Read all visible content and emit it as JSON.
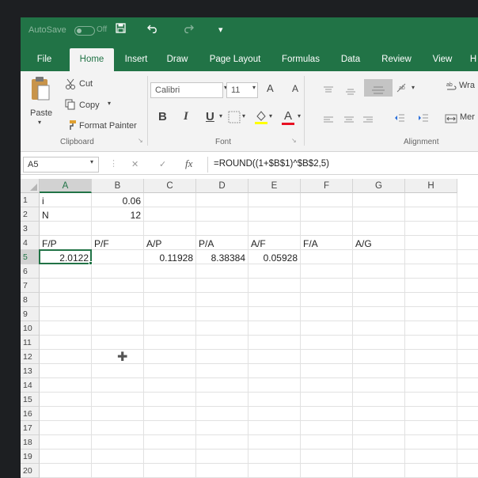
{
  "titlebar": {
    "autosave_label": "AutoSave",
    "autosave_state": "Off",
    "quick_access": [
      "save-icon",
      "undo-icon",
      "redo-icon",
      "customize-icon"
    ]
  },
  "tabs": [
    "File",
    "Home",
    "Insert",
    "Draw",
    "Page Layout",
    "Formulas",
    "Data",
    "Review",
    "View",
    "H"
  ],
  "active_tab": "Home",
  "ribbon": {
    "clipboard": {
      "paste": "Paste",
      "cut": "Cut",
      "copy": "Copy",
      "format_painter": "Format Painter",
      "label": "Clipboard"
    },
    "font": {
      "font_name": "Calibri",
      "font_size": "11",
      "bold": "B",
      "italic": "I",
      "underline": "U",
      "grow": "A",
      "shrink": "A",
      "label": "Font"
    },
    "alignment": {
      "wrap": "Wra",
      "merge": "Mer",
      "label": "Alignment"
    }
  },
  "formula_bar": {
    "name_box": "A5",
    "fx": "fx",
    "cancel": "✕",
    "enter": "✓",
    "formula": "=ROUND((1+$B$1)^$B$2,5)"
  },
  "grid": {
    "columns": [
      "A",
      "B",
      "C",
      "D",
      "E",
      "F",
      "G",
      "H"
    ],
    "rows": [
      "1",
      "2",
      "3",
      "4",
      "5",
      "6",
      "7",
      "8",
      "9",
      "10",
      "11",
      "12",
      "13",
      "14",
      "15",
      "16",
      "17",
      "18",
      "19",
      "20"
    ],
    "active_cell": "A5",
    "cells": {
      "A1": "i",
      "B1": "0.06",
      "A2": "N",
      "B2": "12",
      "A4": "F/P",
      "B4": "P/F",
      "C4": "A/P",
      "D4": "P/A",
      "E4": "A/F",
      "F4": "F/A",
      "G4": "A/G",
      "A5": "2.0122",
      "C5": "0.11928",
      "D5": "8.38384",
      "E5": "0.05928"
    }
  },
  "colors": {
    "accent": "#217346",
    "ribbon_bg": "#f3f3f3",
    "font_color_underline": "#e81123",
    "highlight_underline": "#ffff00"
  }
}
